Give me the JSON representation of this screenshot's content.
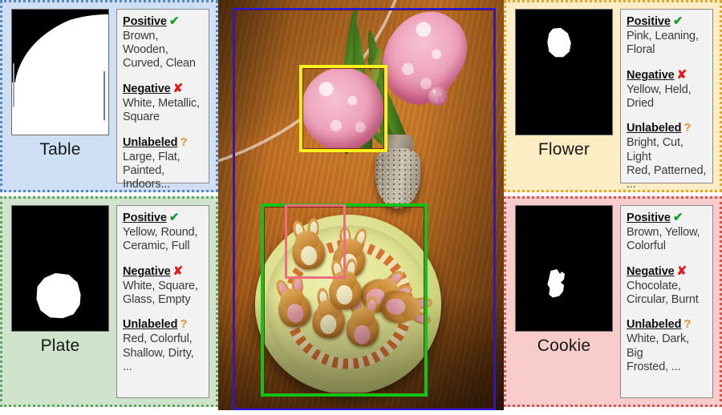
{
  "panels": [
    {
      "id": "table",
      "label": "Table",
      "mask_icon": "binary-segmentation-mask",
      "box_color": "#2318e8",
      "panel_bg": "#cfe0f5",
      "panel_border": "#5b86c4",
      "groups": [
        {
          "head": "Positive",
          "mark": "✔",
          "mark_class": "mark-pos",
          "values": "Brown, Wooden,\nCurved, Clean"
        },
        {
          "head": "Negative",
          "mark": "✘",
          "mark_class": "mark-neg",
          "values": "White, Metallic,\nSquare"
        },
        {
          "head": "Unlabeled",
          "mark": "?",
          "mark_class": "mark-unk",
          "values": "Large, Flat,\nPainted, Indoors..."
        }
      ]
    },
    {
      "id": "plate",
      "label": "Plate",
      "mask_icon": "binary-segmentation-mask",
      "box_color": "#0fc617",
      "panel_bg": "#cfe3cd",
      "panel_border": "#64a361",
      "groups": [
        {
          "head": "Positive",
          "mark": "✔",
          "mark_class": "mark-pos",
          "values": "Yellow, Round,\nCeramic, Full"
        },
        {
          "head": "Negative",
          "mark": "✘",
          "mark_class": "mark-neg",
          "values": "White, Square,\nGlass, Empty"
        },
        {
          "head": "Unlabeled",
          "mark": "?",
          "mark_class": "mark-unk",
          "values": "Red, Colorful,\nShallow, Dirty, ..."
        }
      ]
    },
    {
      "id": "flower",
      "label": "Flower",
      "mask_icon": "binary-segmentation-mask",
      "box_color": "#fbf11c",
      "panel_bg": "#fcedc4",
      "panel_border": "#e0a72c",
      "groups": [
        {
          "head": "Positive",
          "mark": "✔",
          "mark_class": "mark-pos",
          "values": "Pink, Leaning,\nFloral"
        },
        {
          "head": "Negative",
          "mark": "✘",
          "mark_class": "mark-neg",
          "values": "Yellow, Held,\nDried"
        },
        {
          "head": "Unlabeled",
          "mark": "?",
          "mark_class": "mark-unk",
          "values": "Bright, Cut, Light\nRed, Patterned, ..."
        }
      ]
    },
    {
      "id": "cookie",
      "label": "Cookie",
      "mask_icon": "binary-segmentation-mask",
      "box_color": "#ef6d80",
      "panel_bg": "#f7ccca",
      "panel_border": "#d4544f",
      "groups": [
        {
          "head": "Positive",
          "mark": "✔",
          "mark_class": "mark-pos",
          "values": "Brown, Yellow,\nColorful"
        },
        {
          "head": "Negative",
          "mark": "✘",
          "mark_class": "mark-neg",
          "values": "Chocolate,\nCircular, Burnt"
        },
        {
          "head": "Unlabeled",
          "mark": "?",
          "mark_class": "mark-unk",
          "values": "White, Dark, Big\nFrosted, ..."
        }
      ]
    }
  ],
  "photo": {
    "description": "overhead photo of a wooden table with a pink hyacinth in a stone vase and a yellow plate of bunny-shaped cookies",
    "boxes": [
      {
        "name": "table",
        "color": "#2318e8"
      },
      {
        "name": "flower",
        "color": "#fbf11c"
      },
      {
        "name": "plate",
        "color": "#0fc617"
      },
      {
        "name": "cookie",
        "color": "#ef6d80"
      }
    ]
  }
}
